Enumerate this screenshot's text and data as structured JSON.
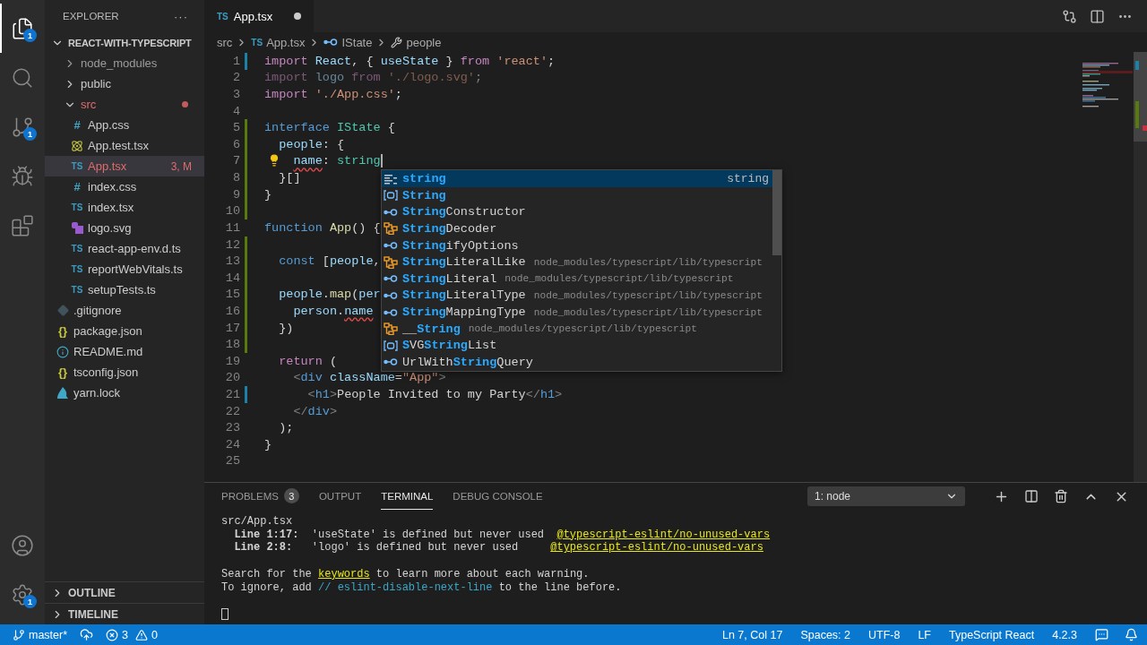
{
  "activity_bar": {
    "top": [
      {
        "kind": "explorer",
        "selected": true,
        "badge": "1"
      },
      {
        "kind": "search",
        "selected": false
      },
      {
        "kind": "source-control",
        "selected": false,
        "badge": "1"
      },
      {
        "kind": "run",
        "selected": false
      },
      {
        "kind": "extensions",
        "selected": false
      }
    ],
    "bottom": [
      {
        "kind": "account"
      },
      {
        "kind": "settings",
        "badge": "1"
      }
    ]
  },
  "explorer": {
    "title": "EXPLORER",
    "more": "···",
    "root": {
      "label": "REACT-WITH-TYPESCRIPT",
      "expanded": true,
      "children": [
        {
          "kind": "folder",
          "label": "node_modules",
          "expanded": false,
          "ignored": true,
          "modified": false
        },
        {
          "kind": "folder",
          "label": "public",
          "expanded": false,
          "ignored": false,
          "modified": false
        },
        {
          "kind": "folder",
          "label": "src",
          "expanded": true,
          "ignored": false,
          "modified": true,
          "children": [
            {
              "kind": "css",
              "glyph": "#",
              "label": "App.css",
              "selected": false,
              "modified": false
            },
            {
              "kind": "react",
              "label": "App.test.tsx",
              "selected": false,
              "modified": false
            },
            {
              "kind": "ts",
              "glyph": "TS",
              "label": "App.tsx",
              "selected": true,
              "modified": true,
              "badge": "3, M"
            },
            {
              "kind": "css",
              "glyph": "#",
              "label": "index.css",
              "selected": false,
              "modified": false
            },
            {
              "kind": "ts",
              "glyph": "TS",
              "label": "index.tsx",
              "selected": false,
              "modified": false
            },
            {
              "kind": "svg",
              "label": "logo.svg",
              "selected": false,
              "modified": false
            },
            {
              "kind": "ts",
              "glyph": "TS",
              "label": "react-app-env.d.ts",
              "selected": false,
              "modified": false
            },
            {
              "kind": "ts",
              "glyph": "TS",
              "label": "reportWebVitals.ts",
              "selected": false,
              "modified": false
            },
            {
              "kind": "ts",
              "glyph": "TS",
              "label": "setupTests.ts",
              "selected": false,
              "modified": false
            }
          ]
        },
        {
          "kind": "git",
          "label": ".gitignore",
          "selected": false,
          "modified": false
        },
        {
          "kind": "json",
          "glyph": "{}",
          "label": "package.json",
          "selected": false,
          "modified": false
        },
        {
          "kind": "info",
          "label": "README.md",
          "selected": false,
          "modified": false
        },
        {
          "kind": "json",
          "glyph": "{}",
          "label": "tsconfig.json",
          "selected": false,
          "modified": false
        },
        {
          "kind": "yarn",
          "label": "yarn.lock",
          "selected": false,
          "modified": false
        }
      ]
    },
    "sections": [
      {
        "label": "OUTLINE",
        "expanded": false
      },
      {
        "label": "TIMELINE",
        "expanded": false
      }
    ]
  },
  "editor_tab": {
    "glyph": "TS",
    "label": "App.tsx",
    "selected": true,
    "dirty": true
  },
  "breadcrumbs": [
    {
      "kind": "folder",
      "label": "src"
    },
    {
      "kind": "file",
      "glyph": "TS",
      "label": "App.tsx"
    },
    {
      "kind": "interface",
      "label": "IState"
    },
    {
      "kind": "property",
      "label": "people"
    }
  ],
  "code": [
    {
      "n": "1",
      "modified": true,
      "tokens": [
        {
          "kind": "kw",
          "t": "import "
        },
        {
          "kind": "var",
          "t": "React"
        },
        {
          "kind": "plain",
          "t": ", { "
        },
        {
          "kind": "var",
          "t": "useState"
        },
        {
          "kind": "plain",
          "t": " } "
        },
        {
          "kind": "kw",
          "t": "from "
        },
        {
          "kind": "str",
          "t": "'react'"
        },
        {
          "kind": "plain",
          "t": ";"
        }
      ]
    },
    {
      "n": "2",
      "faded": true,
      "tokens": [
        {
          "kind": "kw",
          "t": "import "
        },
        {
          "kind": "var",
          "t": "logo "
        },
        {
          "kind": "kw",
          "t": "from "
        },
        {
          "kind": "str",
          "t": "'./logo.svg'"
        },
        {
          "kind": "plain",
          "t": ";"
        }
      ]
    },
    {
      "n": "3",
      "tokens": [
        {
          "kind": "kw",
          "t": "import "
        },
        {
          "kind": "str",
          "t": "'./App.css'"
        },
        {
          "kind": "plain",
          "t": ";"
        }
      ]
    },
    {
      "n": "4"
    },
    {
      "n": "5",
      "added": true,
      "tokens": [
        {
          "kind": "decl",
          "t": "interface "
        },
        {
          "kind": "type",
          "t": "IState"
        },
        {
          "kind": "plain",
          "t": " {"
        }
      ]
    },
    {
      "n": "6",
      "added": true,
      "tokens": [
        {
          "kind": "var",
          "t": "  people"
        },
        {
          "kind": "plain",
          "t": ": {"
        }
      ]
    },
    {
      "n": "7",
      "added": true,
      "lightbulb": true,
      "cursor": true,
      "tokens": [
        {
          "kind": "var",
          "t": "    name",
          "err": true
        },
        {
          "kind": "plain",
          "t": ": "
        },
        {
          "kind": "type",
          "t": "string"
        }
      ]
    },
    {
      "n": "8",
      "added": true,
      "tokens": [
        {
          "kind": "plain",
          "t": "  }[]"
        }
      ]
    },
    {
      "n": "9",
      "added": true,
      "tokens": [
        {
          "kind": "plain",
          "t": "}"
        }
      ]
    },
    {
      "n": "10",
      "added": true
    },
    {
      "n": "11",
      "tokens": [
        {
          "kind": "decl",
          "t": "function "
        },
        {
          "kind": "fn",
          "t": "App"
        },
        {
          "kind": "plain",
          "t": "() {"
        }
      ]
    },
    {
      "n": "12",
      "added": true
    },
    {
      "n": "13",
      "added": true,
      "tokens": [
        {
          "kind": "decl",
          "t": "  const "
        },
        {
          "kind": "plain",
          "t": "["
        },
        {
          "kind": "var",
          "t": "people"
        },
        {
          "kind": "plain",
          "t": ","
        }
      ]
    },
    {
      "n": "14",
      "added": true
    },
    {
      "n": "15",
      "added": true,
      "tokens": [
        {
          "kind": "var",
          "t": "  people"
        },
        {
          "kind": "plain",
          "t": "."
        },
        {
          "kind": "fn",
          "t": "map"
        },
        {
          "kind": "plain",
          "t": "("
        },
        {
          "kind": "var",
          "t": "per"
        }
      ]
    },
    {
      "n": "16",
      "added": true,
      "tokens": [
        {
          "kind": "var",
          "t": "    person"
        },
        {
          "kind": "plain",
          "t": "."
        },
        {
          "kind": "var",
          "t": "name",
          "err": true
        }
      ]
    },
    {
      "n": "17",
      "added": true,
      "tokens": [
        {
          "kind": "plain",
          "t": "  })"
        }
      ]
    },
    {
      "n": "18",
      "added": true
    },
    {
      "n": "19",
      "tokens": [
        {
          "kind": "kw",
          "t": "  return "
        },
        {
          "kind": "plain",
          "t": "("
        }
      ]
    },
    {
      "n": "20",
      "tokens": [
        {
          "kind": "punct",
          "t": "    <"
        },
        {
          "kind": "tag",
          "t": "div "
        },
        {
          "kind": "var",
          "t": "className"
        },
        {
          "kind": "plain",
          "t": "="
        },
        {
          "kind": "str",
          "t": "\"App\""
        },
        {
          "kind": "punct",
          "t": ">"
        }
      ]
    },
    {
      "n": "21",
      "modified": true,
      "tokens": [
        {
          "kind": "punct",
          "t": "      <"
        },
        {
          "kind": "tag",
          "t": "h1"
        },
        {
          "kind": "punct",
          "t": ">"
        },
        {
          "kind": "plain",
          "t": "People Invited to my Party"
        },
        {
          "kind": "punct",
          "t": "</"
        },
        {
          "kind": "tag",
          "t": "h1"
        },
        {
          "kind": "punct",
          "t": ">"
        }
      ]
    },
    {
      "n": "22",
      "tokens": [
        {
          "kind": "punct",
          "t": "    </"
        },
        {
          "kind": "tag",
          "t": "div"
        },
        {
          "kind": "punct",
          "t": ">"
        }
      ]
    },
    {
      "n": "23",
      "tokens": [
        {
          "kind": "plain",
          "t": "  );"
        }
      ]
    },
    {
      "n": "24",
      "tokens": [
        {
          "kind": "plain",
          "t": "}"
        }
      ]
    },
    {
      "n": "25"
    }
  ],
  "suggestions": [
    {
      "kind": "keyword",
      "selected": true,
      "parts": [
        {
          "t": "string",
          "match": true
        }
      ],
      "detail": "string"
    },
    {
      "kind": "variable",
      "selected": false,
      "parts": [
        {
          "t": "String",
          "match": true
        }
      ]
    },
    {
      "kind": "interface",
      "selected": false,
      "parts": [
        {
          "t": "String",
          "match": true
        },
        {
          "t": "Constructor",
          "match": false
        }
      ]
    },
    {
      "kind": "class",
      "selected": false,
      "parts": [
        {
          "t": "String",
          "match": true
        },
        {
          "t": "Decoder",
          "match": false
        }
      ]
    },
    {
      "kind": "interface",
      "selected": false,
      "parts": [
        {
          "t": "String",
          "match": true
        },
        {
          "t": "ifyOptions",
          "match": false
        }
      ]
    },
    {
      "kind": "class",
      "selected": false,
      "parts": [
        {
          "t": "String",
          "match": true
        },
        {
          "t": "LiteralLike",
          "match": false
        }
      ],
      "detail": "node_modules/typescript/lib/typescript"
    },
    {
      "kind": "interface",
      "selected": false,
      "parts": [
        {
          "t": "String",
          "match": true
        },
        {
          "t": "Literal",
          "match": false
        }
      ],
      "detail": "node_modules/typescript/lib/typescript"
    },
    {
      "kind": "interface",
      "selected": false,
      "parts": [
        {
          "t": "String",
          "match": true
        },
        {
          "t": "LiteralType",
          "match": false
        }
      ],
      "detail": "node_modules/typescript/lib/typescript"
    },
    {
      "kind": "interface",
      "selected": false,
      "parts": [
        {
          "t": "String",
          "match": true
        },
        {
          "t": "MappingType",
          "match": false
        }
      ],
      "detail": "node_modules/typescript/lib/typescript"
    },
    {
      "kind": "class",
      "selected": false,
      "parts": [
        {
          "t": "__",
          "match": false
        },
        {
          "t": "String",
          "match": true
        }
      ],
      "detail": "node_modules/typescript/lib/typescript"
    },
    {
      "kind": "variable",
      "selected": false,
      "parts": [
        {
          "t": "S",
          "match": true
        },
        {
          "t": "VG",
          "match": false
        },
        {
          "t": "String",
          "match": true
        },
        {
          "t": "List",
          "match": false
        }
      ]
    },
    {
      "kind": "interface",
      "selected": false,
      "parts": [
        {
          "t": "UrlWith",
          "match": false
        },
        {
          "t": "String",
          "match": true
        },
        {
          "t": "Query",
          "match": false
        }
      ]
    }
  ],
  "panel": {
    "tabs": [
      {
        "label": "PROBLEMS",
        "badge": "3",
        "selected": false
      },
      {
        "label": "OUTPUT",
        "selected": false
      },
      {
        "label": "TERMINAL",
        "selected": true
      },
      {
        "label": "DEBUG CONSOLE",
        "selected": false
      }
    ],
    "terminal_select": "1: node",
    "terminal": [
      {
        "parts": [
          {
            "kind": "plain",
            "t": "src/App.tsx"
          }
        ]
      },
      {
        "parts": [
          {
            "kind": "bold",
            "t": "  Line 1:17:"
          },
          {
            "kind": "plain",
            "t": "  'useState' is defined but never used  "
          },
          {
            "kind": "link",
            "t": "@typescript-eslint/no-unused-vars"
          }
        ]
      },
      {
        "parts": [
          {
            "kind": "bold",
            "t": "  Line 2:8:"
          },
          {
            "kind": "plain",
            "t": "   'logo' is defined but never used     "
          },
          {
            "kind": "link",
            "t": "@typescript-eslint/no-unused-vars"
          }
        ]
      },
      {
        "space_before": true,
        "parts": [
          {
            "kind": "plain",
            "t": "Search for the "
          },
          {
            "kind": "link",
            "t": "keywords"
          },
          {
            "kind": "plain",
            "t": " to learn more about each warning."
          }
        ]
      },
      {
        "parts": [
          {
            "kind": "plain",
            "t": "To ignore, add "
          },
          {
            "kind": "comment",
            "t": "// eslint-disable-next-line"
          },
          {
            "kind": "plain",
            "t": " to the line before."
          }
        ]
      }
    ]
  },
  "status_bar": {
    "branch": "master*",
    "errors": "3",
    "warnings": "0",
    "items": [
      "Ln 7, Col 17",
      "Spaces: 2",
      "UTF-8",
      "LF",
      "TypeScript React",
      "4.2.3"
    ]
  }
}
